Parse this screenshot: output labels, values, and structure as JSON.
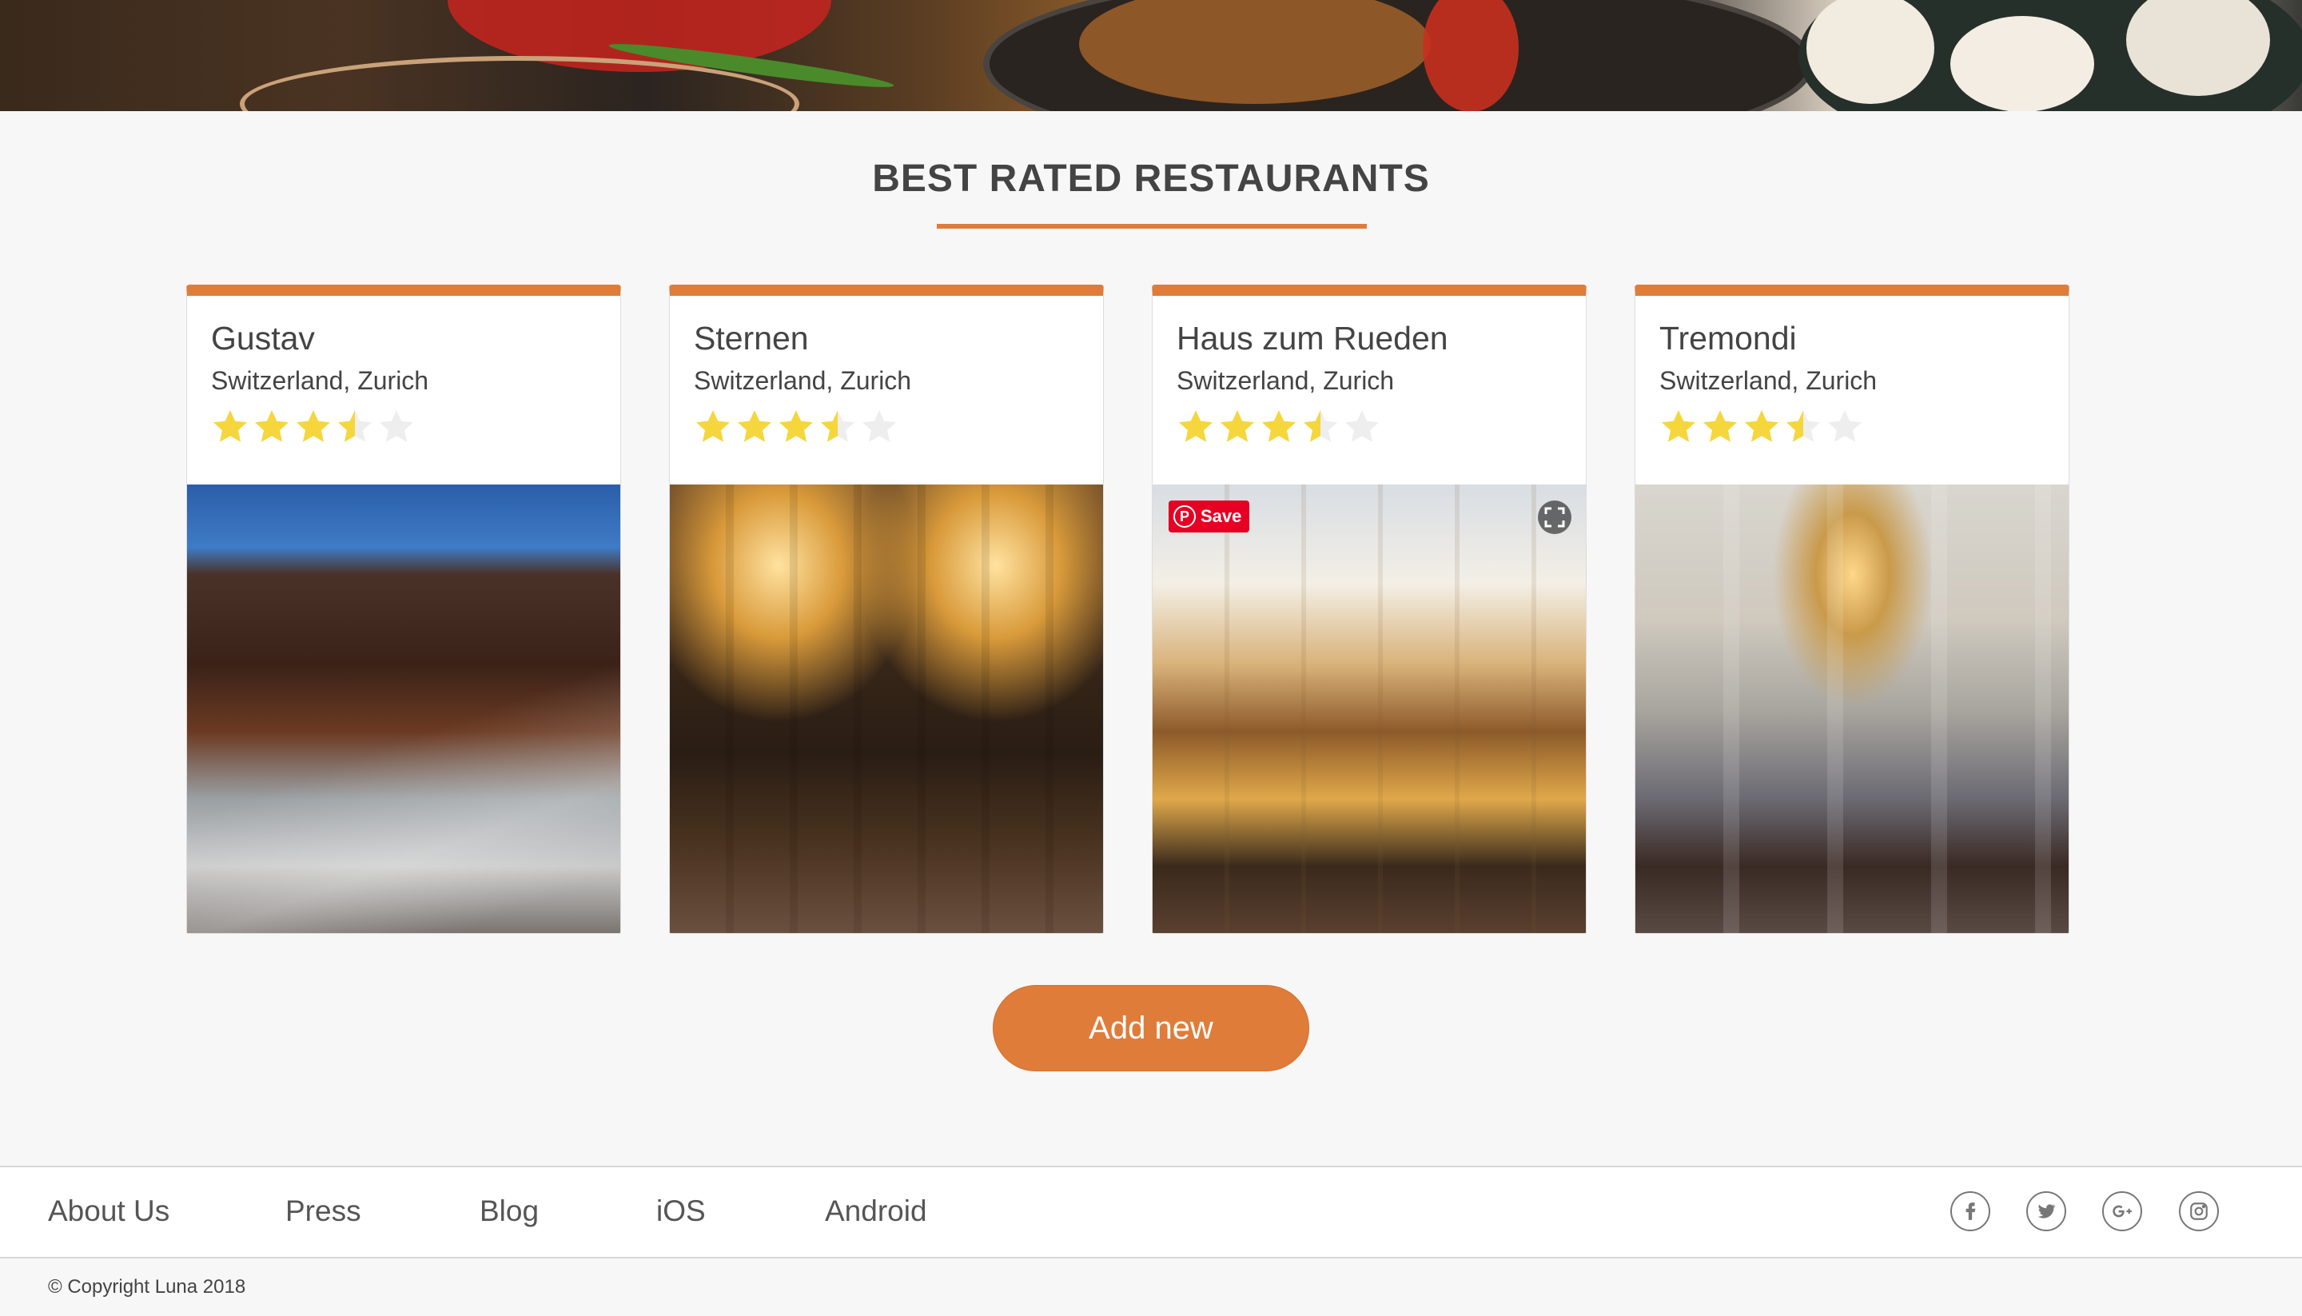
{
  "section": {
    "title": "BEST RATED RESTAURANTS"
  },
  "restaurants": [
    {
      "name": "Gustav",
      "location": "Switzerland, Zurich",
      "rating": 3.5,
      "max_rating": 5
    },
    {
      "name": "Sternen",
      "location": "Switzerland, Zurich",
      "rating": 3.5,
      "max_rating": 5
    },
    {
      "name": "Haus zum Rueden",
      "location": "Switzerland, Zurich",
      "rating": 3.5,
      "max_rating": 5
    },
    {
      "name": "Tremondi",
      "location": "Switzerland, Zurich",
      "rating": 3.5,
      "max_rating": 5
    }
  ],
  "pinterest": {
    "save_label": "Save"
  },
  "actions": {
    "add_new_label": "Add new"
  },
  "footer": {
    "links": [
      "About Us",
      "Press",
      "Blog",
      "iOS",
      "Android"
    ],
    "social_icons": [
      "facebook-icon",
      "twitter-icon",
      "google-plus-icon",
      "instagram-icon"
    ],
    "copyright": "© Copyright Luna 2018"
  },
  "colors": {
    "accent": "#e07c3a",
    "star_filled": "#f5d63d",
    "star_empty": "#eeeeee",
    "background": "#f7f7f7"
  }
}
